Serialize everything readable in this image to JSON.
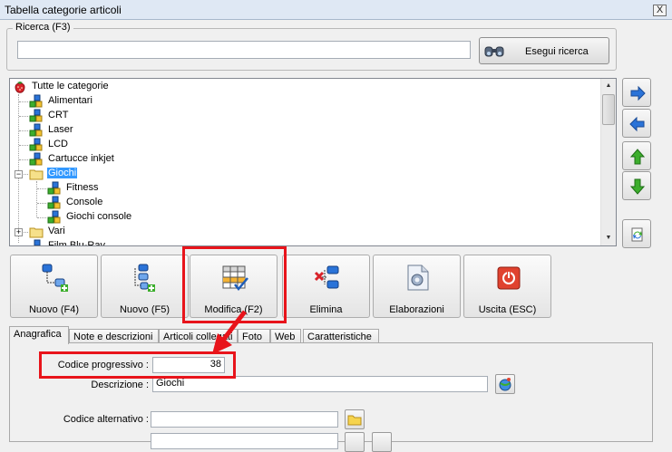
{
  "window": {
    "title": "Tabella categorie articoli",
    "close_glyph": "X"
  },
  "search": {
    "legend": "Ricerca (F3)",
    "input_value": "",
    "button_label": "Esegui ricerca",
    "button_icon": "binoculars-icon"
  },
  "tree": {
    "root": "Tutte le categorie",
    "items": [
      {
        "label": "Alimentari",
        "icon": "category-cubes-icon"
      },
      {
        "label": "CRT",
        "icon": "category-cubes-icon"
      },
      {
        "label": "Laser",
        "icon": "category-cubes-icon"
      },
      {
        "label": "LCD",
        "icon": "category-cubes-icon"
      },
      {
        "label": "Cartucce inkjet",
        "icon": "category-cubes-icon"
      },
      {
        "label": "Giochi",
        "icon": "folder-icon",
        "expander": "−",
        "selected": true
      },
      {
        "label": "Fitness",
        "icon": "category-cubes-icon"
      },
      {
        "label": "Console",
        "icon": "category-cubes-icon"
      },
      {
        "label": "Giochi console",
        "icon": "category-cubes-icon"
      },
      {
        "label": "Vari",
        "icon": "folder-icon",
        "expander": "+"
      },
      {
        "label": "Film Blu-Ray",
        "icon": "category-cubes-icon"
      }
    ]
  },
  "side_buttons": [
    "arrow-right-icon",
    "arrow-left-icon",
    "arrow-up-icon",
    "arrow-down-icon",
    "refresh-icon"
  ],
  "toolbar": {
    "new_f4": "Nuovo (F4)",
    "new_f5": "Nuovo (F5)",
    "edit": "Modifica (F2)",
    "delete": "Elimina",
    "process": "Elaborazioni",
    "exit": "Uscita (ESC)"
  },
  "tabs": [
    "Anagrafica",
    "Note e descrizioni",
    "Articoli collegati",
    "Foto",
    "Web",
    "Caratteristiche"
  ],
  "form": {
    "codice_label": "Codice progressivo :",
    "codice_value": "38",
    "descrizione_label": "Descrizione :",
    "descrizione_value": "Giochi",
    "alternativo_label": "Codice alternativo :",
    "alternativo_value": ""
  },
  "colors": {
    "highlight": "#e8141b",
    "selection": "#3399ff",
    "accent_green": "#3cae2c",
    "accent_blue": "#2a73d8"
  }
}
